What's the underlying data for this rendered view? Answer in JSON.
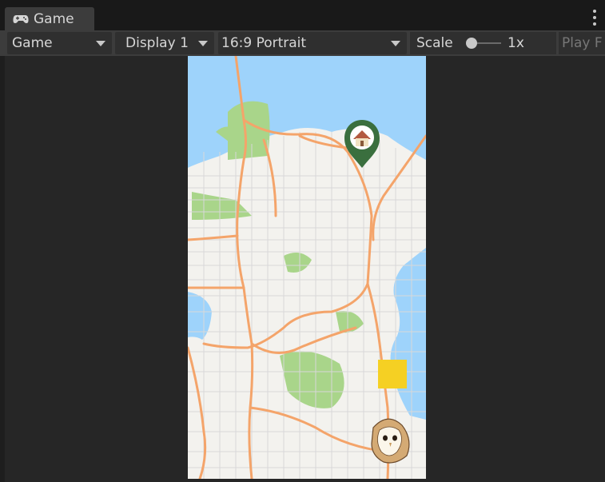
{
  "tab": {
    "icon": "gamepad-icon",
    "label": "Game"
  },
  "toolbar": {
    "target": {
      "value": "Game"
    },
    "display": {
      "value": "Display 1"
    },
    "aspect": {
      "value": "16:9 Portrait"
    },
    "scale": {
      "label": "Scale",
      "value": "1x",
      "slider_position": 0.1
    },
    "play_focused": {
      "label": "Play F"
    }
  },
  "map": {
    "home_marker": {
      "icon": "home-pin-icon",
      "color": "#3a6f3e"
    },
    "target_square": {
      "color": "#f5d023"
    },
    "player": {
      "icon": "barn-owl-icon"
    }
  },
  "colors": {
    "water": "#9ed3fb",
    "land": "#f3f2ee",
    "park": "#a9d58a",
    "major_road": "#f4a46a",
    "minor_road": "#d8d8d8"
  }
}
